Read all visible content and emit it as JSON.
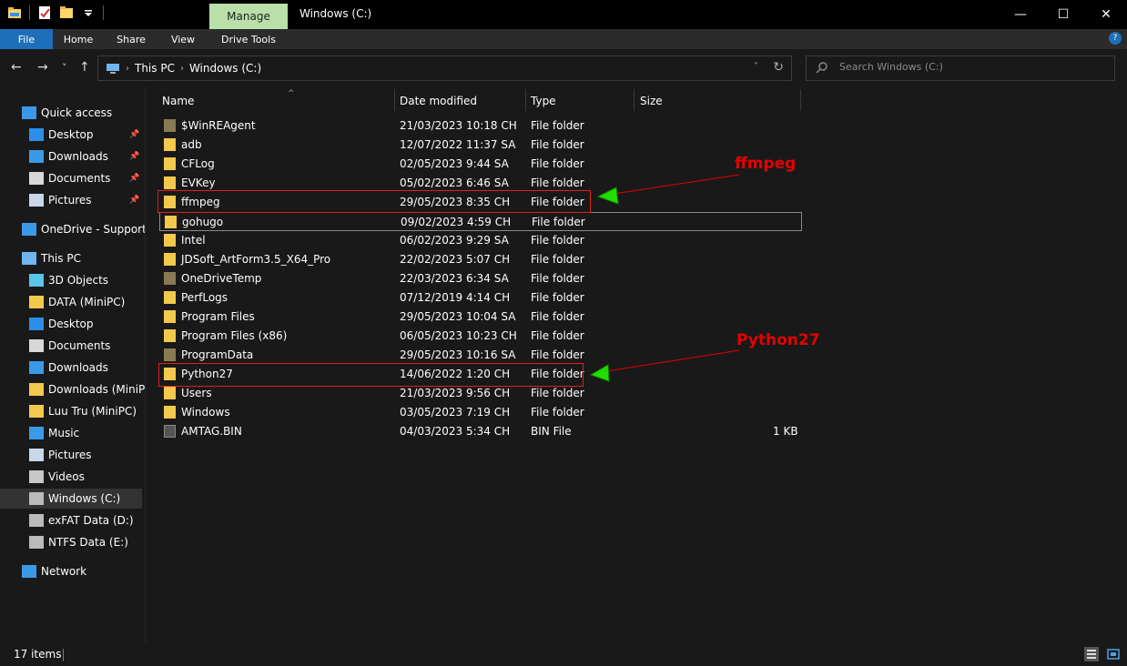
{
  "window": {
    "title": "Windows (C:)",
    "context_tab": "Manage",
    "minimize_glyph": "—",
    "maximize_glyph": "☐",
    "close_glyph": "✕"
  },
  "ribbon": {
    "tabs": [
      "File",
      "Home",
      "Share",
      "View",
      "Drive Tools"
    ],
    "help_glyph": "?"
  },
  "nav": {
    "back_glyph": "←",
    "forward_glyph": "→",
    "recent_glyph": "˅",
    "up_glyph": "↑"
  },
  "address": {
    "crumbs": [
      "This PC",
      "Windows (C:)"
    ],
    "separator": "›",
    "dropdown_glyph": "˅",
    "refresh_glyph": "↻"
  },
  "search": {
    "placeholder": "Search Windows (C:)",
    "icon": "search-icon"
  },
  "columns": {
    "name": "Name",
    "date": "Date modified",
    "type": "Type",
    "size": "Size",
    "sort_glyph": "^"
  },
  "sidebar": {
    "items": [
      {
        "label": "Quick access",
        "icon": "star-icon"
      },
      {
        "label": "Desktop",
        "icon": "desktop-icon",
        "pinned": true
      },
      {
        "label": "Downloads",
        "icon": "downloads-icon",
        "pinned": true
      },
      {
        "label": "Documents",
        "icon": "documents-icon",
        "pinned": true
      },
      {
        "label": "Pictures",
        "icon": "pictures-icon",
        "pinned": true
      },
      {
        "label": "OneDrive - Support F",
        "icon": "onedrive-icon"
      },
      {
        "label": "This PC",
        "icon": "this-pc-icon"
      },
      {
        "label": "3D Objects",
        "icon": "3d-objects-icon"
      },
      {
        "label": "DATA (MiniPC)",
        "icon": "folder-icon"
      },
      {
        "label": "Desktop",
        "icon": "desktop-icon"
      },
      {
        "label": "Documents",
        "icon": "documents-icon"
      },
      {
        "label": "Downloads",
        "icon": "downloads-icon"
      },
      {
        "label": "Downloads (MiniPC",
        "icon": "folder-icon"
      },
      {
        "label": "Luu Tru (MiniPC)",
        "icon": "folder-icon"
      },
      {
        "label": "Music",
        "icon": "music-icon"
      },
      {
        "label": "Pictures",
        "icon": "pictures-icon"
      },
      {
        "label": "Videos",
        "icon": "videos-icon"
      },
      {
        "label": "Windows (C:)",
        "icon": "drive-icon",
        "selected": true
      },
      {
        "label": "exFAT Data (D:)",
        "icon": "drive-icon"
      },
      {
        "label": "NTFS Data (E:)",
        "icon": "drive-icon"
      },
      {
        "label": "Network",
        "icon": "network-icon"
      }
    ],
    "pin_glyph": "📌"
  },
  "files": [
    {
      "name": "$WinREAgent",
      "date": "21/03/2023 10:18 CH",
      "type": "File folder",
      "size": "",
      "kind": "sys"
    },
    {
      "name": "adb",
      "date": "12/07/2022 11:37 SA",
      "type": "File folder",
      "size": "",
      "kind": "folder"
    },
    {
      "name": "CFLog",
      "date": "02/05/2023 9:44 SA",
      "type": "File folder",
      "size": "",
      "kind": "folder"
    },
    {
      "name": "EVKey",
      "date": "05/02/2023 6:46 SA",
      "type": "File folder",
      "size": "",
      "kind": "folder"
    },
    {
      "name": "ffmpeg",
      "date": "29/05/2023 8:35 CH",
      "type": "File folder",
      "size": "",
      "kind": "folder"
    },
    {
      "name": "gohugo",
      "date": "09/02/2023 4:59 CH",
      "type": "File folder",
      "size": "",
      "kind": "folder",
      "focused": true
    },
    {
      "name": "Intel",
      "date": "06/02/2023 9:29 SA",
      "type": "File folder",
      "size": "",
      "kind": "folder"
    },
    {
      "name": "JDSoft_ArtForm3.5_X64_Pro",
      "date": "22/02/2023 5:07 CH",
      "type": "File folder",
      "size": "",
      "kind": "folder"
    },
    {
      "name": "OneDriveTemp",
      "date": "22/03/2023 6:34 SA",
      "type": "File folder",
      "size": "",
      "kind": "sys"
    },
    {
      "name": "PerfLogs",
      "date": "07/12/2019 4:14 CH",
      "type": "File folder",
      "size": "",
      "kind": "folder"
    },
    {
      "name": "Program Files",
      "date": "29/05/2023 10:04 SA",
      "type": "File folder",
      "size": "",
      "kind": "folder"
    },
    {
      "name": "Program Files (x86)",
      "date": "06/05/2023 10:23 CH",
      "type": "File folder",
      "size": "",
      "kind": "folder"
    },
    {
      "name": "ProgramData",
      "date": "29/05/2023 10:16 SA",
      "type": "File folder",
      "size": "",
      "kind": "sys"
    },
    {
      "name": "Python27",
      "date": "14/06/2022 1:20 CH",
      "type": "File folder",
      "size": "",
      "kind": "folder"
    },
    {
      "name": "Users",
      "date": "21/03/2023 9:56 CH",
      "type": "File folder",
      "size": "",
      "kind": "folder"
    },
    {
      "name": "Windows",
      "date": "03/05/2023 7:19 CH",
      "type": "File folder",
      "size": "",
      "kind": "folder"
    },
    {
      "name": "AMTAG.BIN",
      "date": "04/03/2023 5:34 CH",
      "type": "BIN File",
      "size": "1 KB",
      "kind": "bin"
    }
  ],
  "annotations": {
    "ffmpeg": "ffmpeg",
    "python": "Python27",
    "color": "#e60000",
    "arrow_color": "#22dd00"
  },
  "status": {
    "item_count": "17 items"
  },
  "colors": {
    "accent": "#1e6fb9",
    "manage_tab": "#b8e0a8",
    "folder": "#f3c94d"
  }
}
